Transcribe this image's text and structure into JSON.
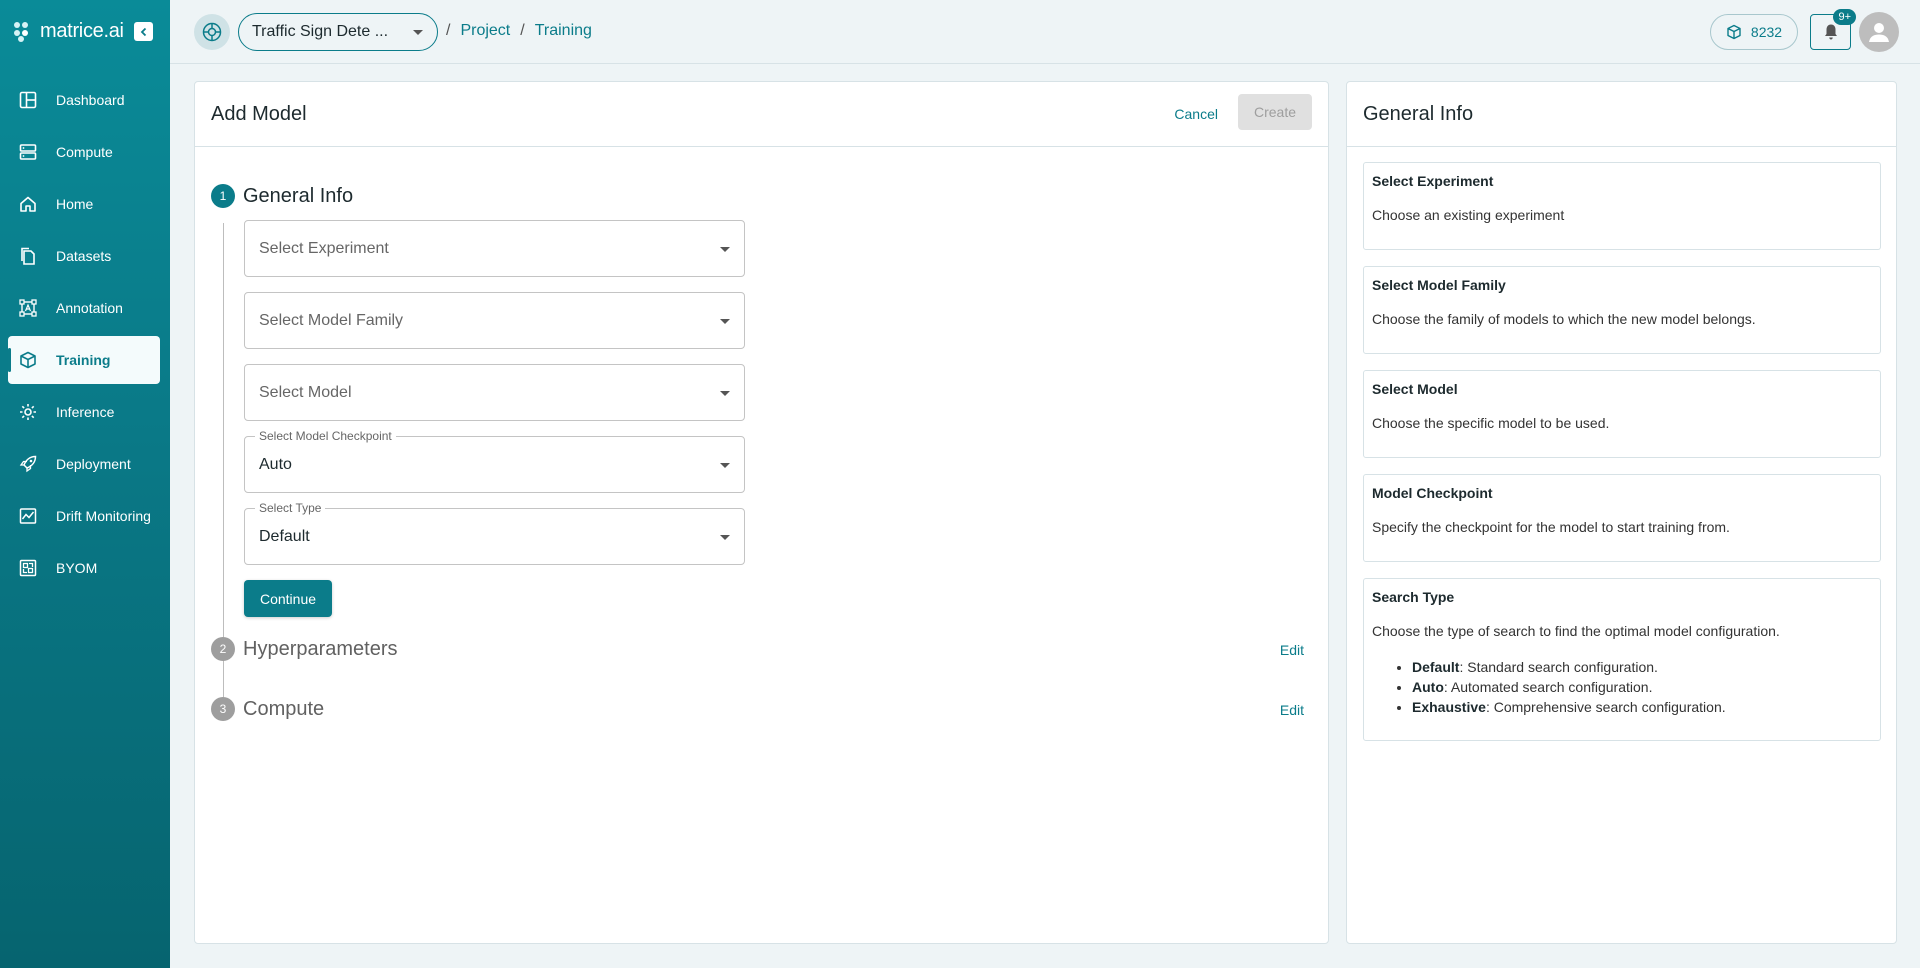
{
  "app": {
    "logo": "matrice.ai"
  },
  "nav": [
    {
      "label": "Dashboard",
      "icon": "dashboard-icon",
      "active": false
    },
    {
      "label": "Compute",
      "icon": "server-icon",
      "active": false
    },
    {
      "label": "Home",
      "icon": "home-icon",
      "active": false
    },
    {
      "label": "Datasets",
      "icon": "files-icon",
      "active": false
    },
    {
      "label": "Annotation",
      "icon": "annotation-icon",
      "active": false
    },
    {
      "label": "Training",
      "icon": "cube-icon",
      "active": true
    },
    {
      "label": "Inference",
      "icon": "gear-icon",
      "active": false
    },
    {
      "label": "Deployment",
      "icon": "rocket-icon",
      "active": false
    },
    {
      "label": "Drift Monitoring",
      "icon": "chart-line-icon",
      "active": false
    },
    {
      "label": "BYOM",
      "icon": "byom-icon",
      "active": false
    }
  ],
  "topbar": {
    "project_name": "Traffic Sign Dete ...",
    "breadcrumbs": [
      "Project",
      "Training"
    ],
    "separator": "/",
    "credits": "8232",
    "notifications_badge": "9+"
  },
  "form": {
    "title": "Add Model",
    "cancel_label": "Cancel",
    "create_label": "Create",
    "steps": [
      {
        "num": "1",
        "title": "General Info"
      },
      {
        "num": "2",
        "title": "Hyperparameters",
        "edit": "Edit"
      },
      {
        "num": "3",
        "title": "Compute",
        "edit": "Edit"
      }
    ],
    "fields": {
      "experiment_placeholder": "Select Experiment",
      "family_placeholder": "Select Model Family",
      "model_placeholder": "Select Model",
      "checkpoint_label": "Select Model Checkpoint",
      "checkpoint_value": "Auto",
      "type_label": "Select Type",
      "type_value": "Default"
    },
    "continue_label": "Continue"
  },
  "info": {
    "title": "General Info",
    "boxes": [
      {
        "title": "Select Experiment",
        "text": "Choose an existing experiment"
      },
      {
        "title": "Select Model Family",
        "text": "Choose the family of models to which the new model belongs."
      },
      {
        "title": "Select Model",
        "text": "Choose the specific model to be used."
      },
      {
        "title": "Model Checkpoint",
        "text": "Specify the checkpoint for the model to start training from."
      },
      {
        "title": "Search Type",
        "text": "Choose the type of search to find the optimal model configuration.",
        "items": [
          {
            "term": "Default",
            "desc": ": Standard search configuration."
          },
          {
            "term": "Auto",
            "desc": ": Automated search configuration."
          },
          {
            "term": "Exhaustive",
            "desc": ": Comprehensive search configuration."
          }
        ]
      }
    ]
  },
  "colors": {
    "accent": "#0b7c8a",
    "sidebar": "#0a7987",
    "background": "#eef4f6"
  }
}
